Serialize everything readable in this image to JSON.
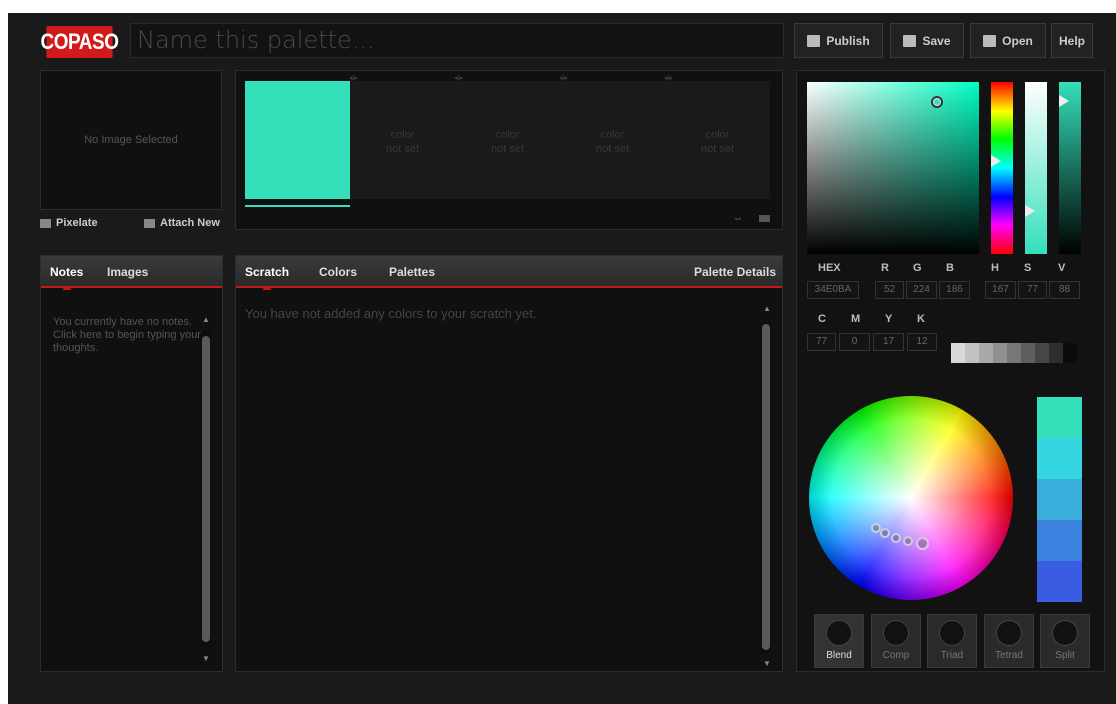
{
  "header": {
    "logo": "COPASO",
    "palette_name_placeholder": "Name this palette...",
    "buttons": {
      "publish": "Publish",
      "save": "Save",
      "open": "Open",
      "help": "Help"
    }
  },
  "image_panel": {
    "empty_text": "No Image Selected",
    "pixelate": "Pixelate",
    "attach_new": "Attach New"
  },
  "swatches": {
    "filled_color": "#34E0BA",
    "empty_line1": "color",
    "empty_line2": "not set"
  },
  "notes_panel": {
    "tabs": [
      "Notes",
      "Images"
    ],
    "active_tab": "Notes",
    "empty_text": "You currently have no notes. Click here to begin typing your thoughts."
  },
  "scratch_panel": {
    "tabs": [
      "Scratch",
      "Colors",
      "Palettes"
    ],
    "active_tab": "Scratch",
    "details": "Palette Details",
    "empty_text": "You have not added any colors to your scratch yet."
  },
  "color_picker": {
    "labels": {
      "hex": "HEX",
      "r": "R",
      "g": "G",
      "b": "B",
      "h": "H",
      "s": "S",
      "v": "V",
      "c": "C",
      "m": "M",
      "y": "Y",
      "k": "K"
    },
    "values": {
      "hex": "34E0BA",
      "r": "52",
      "g": "224",
      "b": "186",
      "h": "167",
      "s": "77",
      "v": "88",
      "c": "77",
      "m": "0",
      "y": "17",
      "k": "12"
    },
    "grays": [
      "#d8d8d8",
      "#c2c2c2",
      "#a9a9a9",
      "#909090",
      "#777777",
      "#5e5e5e",
      "#464646",
      "#2e2e2e",
      "#0c0c0c"
    ],
    "generated": [
      "#34E0BA",
      "#36D6E0",
      "#3AAEDB",
      "#3A82DE",
      "#3A5CE0"
    ],
    "modes": [
      "Blend",
      "Comp",
      "Triad",
      "Tetrad",
      "Split"
    ],
    "active_mode": "Blend"
  }
}
